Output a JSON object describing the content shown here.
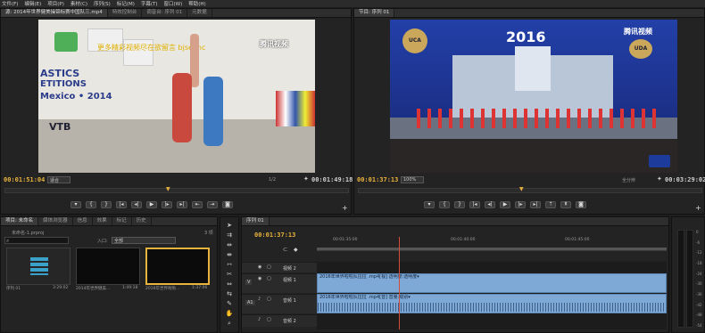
{
  "menu": [
    "文件(F)",
    "编辑(E)",
    "项目(P)",
    "素材(C)",
    "序列(S)",
    "标记(M)",
    "字幕(T)",
    "窗口(W)",
    "帮助(H)"
  ],
  "source": {
    "tabs": [
      "源: 2014年世界健美操锦标赛中国队三.mp4",
      "特效控制台",
      "调音台: 序列 01",
      "元数据"
    ],
    "timecode_in": "00:01:51:04",
    "fit": "适合",
    "ratio": "1/2",
    "timecode_dur": "00:01:49:18",
    "overlay_text": "更多精彩视频尽在欲留言 bjsejmc",
    "watermark": "腾讯视频",
    "banner_lines": [
      "ASTICS",
      "ETITIONS",
      "Mexico • 2014",
      "VTB"
    ]
  },
  "program": {
    "tab": "节目: 序列 01",
    "timecode": "00:01:37:13",
    "fit": "适合",
    "ratio": "100%",
    "quality": "全分辨",
    "timecode_dur": "00:03:29:02",
    "year": "2016",
    "watermark": "腾讯视频",
    "uca": "UCA",
    "uda": "UDA"
  },
  "project": {
    "tabs": [
      "项目: 未命名",
      "媒体浏览器",
      "信息",
      "效果",
      "标记",
      "历史"
    ],
    "file": "未命名-1.prproj",
    "count": "3 项",
    "search_placeholder": "",
    "in_label": "入口:",
    "in_value": "全部",
    "items": [
      {
        "name": "序列 01",
        "duration": "3:29:02"
      },
      {
        "name": "2014年世界健美...",
        "duration": "1:49:18"
      },
      {
        "name": "2016年世界啦啦...",
        "duration": "1:37:06"
      }
    ]
  },
  "timeline": {
    "tab": "序列 01",
    "timecode": "00:01:37:13",
    "ruler": [
      "00:01:35:00",
      "00:01:40:00",
      "00:01:45:00"
    ],
    "tracks": {
      "v2": "视频 2",
      "v1": "视频 1",
      "a1": "音频 1",
      "a2": "音频 2",
      "v1_clip": "2016年世界啦啦队拉拉 .mp4[视] 透明度:透明度▾",
      "a1_clip": "2016年世界啦啦队拉拉 .mp4[音] 音量:级别▾"
    },
    "src_v": "V",
    "src_a": "A1"
  },
  "meter": {
    "labels": [
      "0",
      "-6",
      "-12",
      "-18",
      "-24",
      "-30",
      "-36",
      "-42",
      "-48",
      "-54"
    ]
  }
}
